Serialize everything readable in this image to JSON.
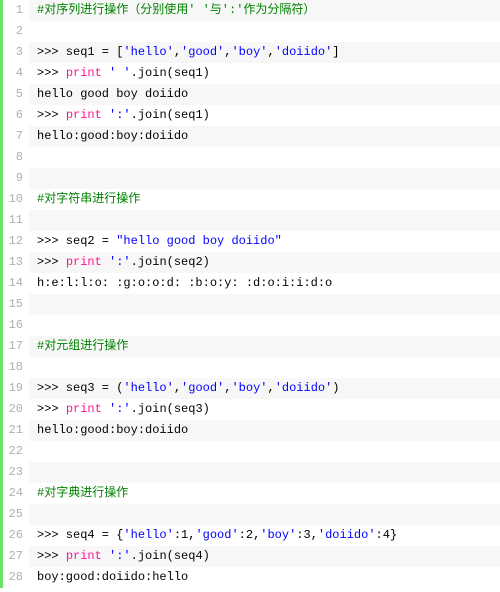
{
  "code": {
    "lines": [
      {
        "n": 1,
        "alt": true,
        "tokens": [
          {
            "t": "#对序列进行操作（分别使用' '与':'作为分隔符）",
            "c": "comment"
          }
        ]
      },
      {
        "n": 2,
        "alt": false,
        "tokens": []
      },
      {
        "n": 3,
        "alt": true,
        "tokens": [
          {
            "t": ">>> seq1 = [",
            "c": "plain"
          },
          {
            "t": "'hello'",
            "c": "string"
          },
          {
            "t": ",",
            "c": "plain"
          },
          {
            "t": "'good'",
            "c": "string"
          },
          {
            "t": ",",
            "c": "plain"
          },
          {
            "t": "'boy'",
            "c": "string"
          },
          {
            "t": ",",
            "c": "plain"
          },
          {
            "t": "'doiido'",
            "c": "string"
          },
          {
            "t": "]",
            "c": "plain"
          }
        ]
      },
      {
        "n": 4,
        "alt": false,
        "tokens": [
          {
            "t": ">>> ",
            "c": "plain"
          },
          {
            "t": "print",
            "c": "keyword"
          },
          {
            "t": " ",
            "c": "plain"
          },
          {
            "t": "' '",
            "c": "string"
          },
          {
            "t": ".join(seq1)",
            "c": "plain"
          }
        ]
      },
      {
        "n": 5,
        "alt": true,
        "tokens": [
          {
            "t": "hello good boy doiido",
            "c": "plain"
          }
        ]
      },
      {
        "n": 6,
        "alt": false,
        "tokens": [
          {
            "t": ">>> ",
            "c": "plain"
          },
          {
            "t": "print",
            "c": "keyword"
          },
          {
            "t": " ",
            "c": "plain"
          },
          {
            "t": "':'",
            "c": "string"
          },
          {
            "t": ".join(seq1)",
            "c": "plain"
          }
        ]
      },
      {
        "n": 7,
        "alt": true,
        "tokens": [
          {
            "t": "hello:good:boy:doiido",
            "c": "plain"
          }
        ]
      },
      {
        "n": 8,
        "alt": false,
        "tokens": []
      },
      {
        "n": 9,
        "alt": true,
        "tokens": []
      },
      {
        "n": 10,
        "alt": false,
        "tokens": [
          {
            "t": "#对字符串进行操作",
            "c": "comment"
          }
        ]
      },
      {
        "n": 11,
        "alt": true,
        "tokens": []
      },
      {
        "n": 12,
        "alt": false,
        "tokens": [
          {
            "t": ">>> seq2 = ",
            "c": "plain"
          },
          {
            "t": "\"hello good boy doiido\"",
            "c": "string"
          }
        ]
      },
      {
        "n": 13,
        "alt": true,
        "tokens": [
          {
            "t": ">>> ",
            "c": "plain"
          },
          {
            "t": "print",
            "c": "keyword"
          },
          {
            "t": " ",
            "c": "plain"
          },
          {
            "t": "':'",
            "c": "string"
          },
          {
            "t": ".join(seq2)",
            "c": "plain"
          }
        ]
      },
      {
        "n": 14,
        "alt": false,
        "tokens": [
          {
            "t": "h:e:l:l:o: :g:o:o:d: :b:o:y: :d:o:i:i:d:o",
            "c": "plain"
          }
        ]
      },
      {
        "n": 15,
        "alt": true,
        "tokens": []
      },
      {
        "n": 16,
        "alt": false,
        "tokens": []
      },
      {
        "n": 17,
        "alt": true,
        "tokens": [
          {
            "t": "#对元组进行操作",
            "c": "comment"
          }
        ]
      },
      {
        "n": 18,
        "alt": false,
        "tokens": []
      },
      {
        "n": 19,
        "alt": true,
        "tokens": [
          {
            "t": ">>> seq3 = (",
            "c": "plain"
          },
          {
            "t": "'hello'",
            "c": "string"
          },
          {
            "t": ",",
            "c": "plain"
          },
          {
            "t": "'good'",
            "c": "string"
          },
          {
            "t": ",",
            "c": "plain"
          },
          {
            "t": "'boy'",
            "c": "string"
          },
          {
            "t": ",",
            "c": "plain"
          },
          {
            "t": "'doiido'",
            "c": "string"
          },
          {
            "t": ")",
            "c": "plain"
          }
        ]
      },
      {
        "n": 20,
        "alt": false,
        "tokens": [
          {
            "t": ">>> ",
            "c": "plain"
          },
          {
            "t": "print",
            "c": "keyword"
          },
          {
            "t": " ",
            "c": "plain"
          },
          {
            "t": "':'",
            "c": "string"
          },
          {
            "t": ".join(seq3)",
            "c": "plain"
          }
        ]
      },
      {
        "n": 21,
        "alt": true,
        "tokens": [
          {
            "t": "hello:good:boy:doiido",
            "c": "plain"
          }
        ]
      },
      {
        "n": 22,
        "alt": false,
        "tokens": []
      },
      {
        "n": 23,
        "alt": true,
        "tokens": []
      },
      {
        "n": 24,
        "alt": false,
        "tokens": [
          {
            "t": "#对字典进行操作",
            "c": "comment"
          }
        ]
      },
      {
        "n": 25,
        "alt": true,
        "tokens": []
      },
      {
        "n": 26,
        "alt": false,
        "tokens": [
          {
            "t": ">>> seq4 = {",
            "c": "plain"
          },
          {
            "t": "'hello'",
            "c": "string"
          },
          {
            "t": ":1,",
            "c": "plain"
          },
          {
            "t": "'good'",
            "c": "string"
          },
          {
            "t": ":2,",
            "c": "plain"
          },
          {
            "t": "'boy'",
            "c": "string"
          },
          {
            "t": ":3,",
            "c": "plain"
          },
          {
            "t": "'doiido'",
            "c": "string"
          },
          {
            "t": ":4}",
            "c": "plain"
          }
        ]
      },
      {
        "n": 27,
        "alt": true,
        "tokens": [
          {
            "t": ">>> ",
            "c": "plain"
          },
          {
            "t": "print",
            "c": "keyword"
          },
          {
            "t": " ",
            "c": "plain"
          },
          {
            "t": "':'",
            "c": "string"
          },
          {
            "t": ".join(seq4)",
            "c": "plain"
          }
        ]
      },
      {
        "n": 28,
        "alt": false,
        "tokens": [
          {
            "t": "boy:good:doiido:hello",
            "c": "plain"
          }
        ]
      }
    ]
  }
}
